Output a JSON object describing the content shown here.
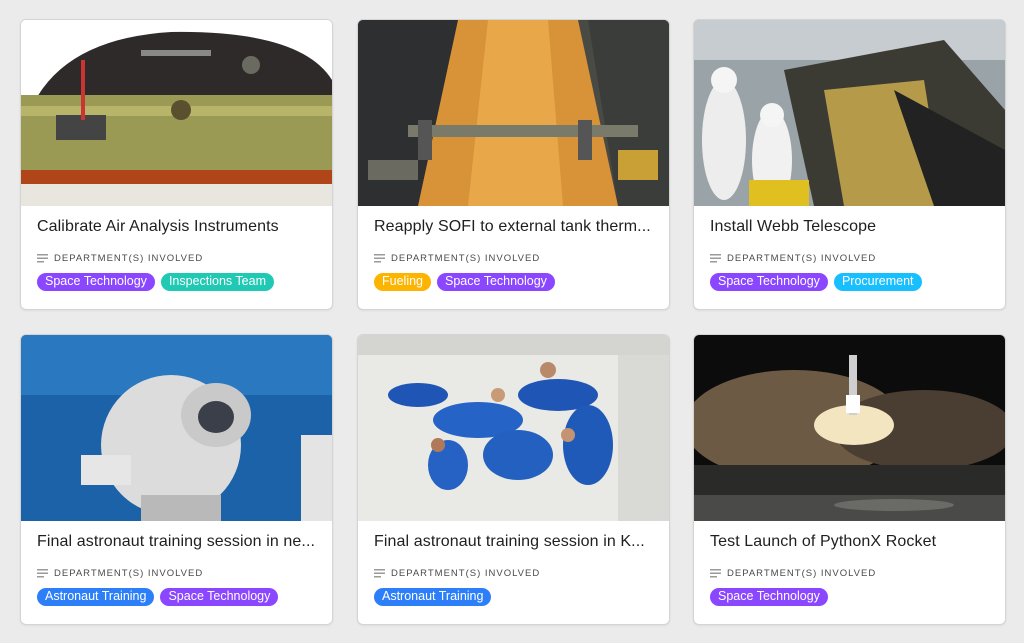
{
  "field_label": "DEPARTMENT(S) INVOLVED",
  "tag_colors": {
    "Space Technology": "#8b46ff",
    "Inspections Team": "#20c9b3",
    "Fueling": "#fcb400",
    "Procurement": "#18bfff",
    "Astronaut Training": "#2d7ff9"
  },
  "cards": [
    {
      "title": "Calibrate Air Analysis Instruments",
      "image": "air-analysis-instrument-photo",
      "tags": [
        "Space Technology",
        "Inspections Team"
      ]
    },
    {
      "title": "Reapply SOFI to external tank therm...",
      "image": "external-tank-photo",
      "tags": [
        "Fueling",
        "Space Technology"
      ]
    },
    {
      "title": "Install Webb Telescope",
      "image": "webb-telescope-cleanroom-photo",
      "tags": [
        "Space Technology",
        "Procurement"
      ]
    },
    {
      "title": "Final astronaut training session in ne...",
      "image": "underwater-astronaut-photo",
      "tags": [
        "Astronaut Training",
        "Space Technology"
      ]
    },
    {
      "title": "Final astronaut training session in K...",
      "image": "zero-gravity-crew-photo",
      "tags": [
        "Astronaut Training"
      ]
    },
    {
      "title": "Test Launch of PythonX Rocket",
      "image": "night-rocket-launch-photo",
      "tags": [
        "Space Technology"
      ]
    }
  ]
}
